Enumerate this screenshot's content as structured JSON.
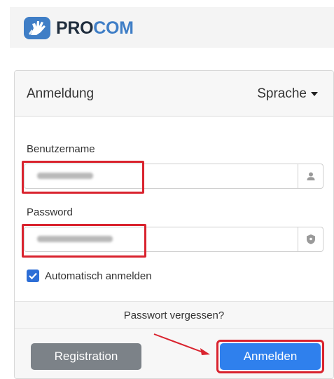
{
  "brand": {
    "name_part1": "PRO",
    "name_part2": "COM",
    "color_dark": "#1f2d3d",
    "color_blue": "#3f7ec6"
  },
  "login_card": {
    "title": "Anmeldung",
    "language_label": "Sprache",
    "username": {
      "label": "Benutzername",
      "value": "",
      "icon": "user-icon"
    },
    "password": {
      "label": "Password",
      "value": "",
      "icon": "shield-icon"
    },
    "remember_me": {
      "label": "Automatisch anmelden",
      "checked": true
    },
    "forgot_password_label": "Passwort vergessen?",
    "register_button_label": "Registration",
    "login_button_label": "Anmelden"
  },
  "colors": {
    "primary": "#2f80ed",
    "secondary": "#6f767d",
    "annotation": "#d9232e"
  }
}
